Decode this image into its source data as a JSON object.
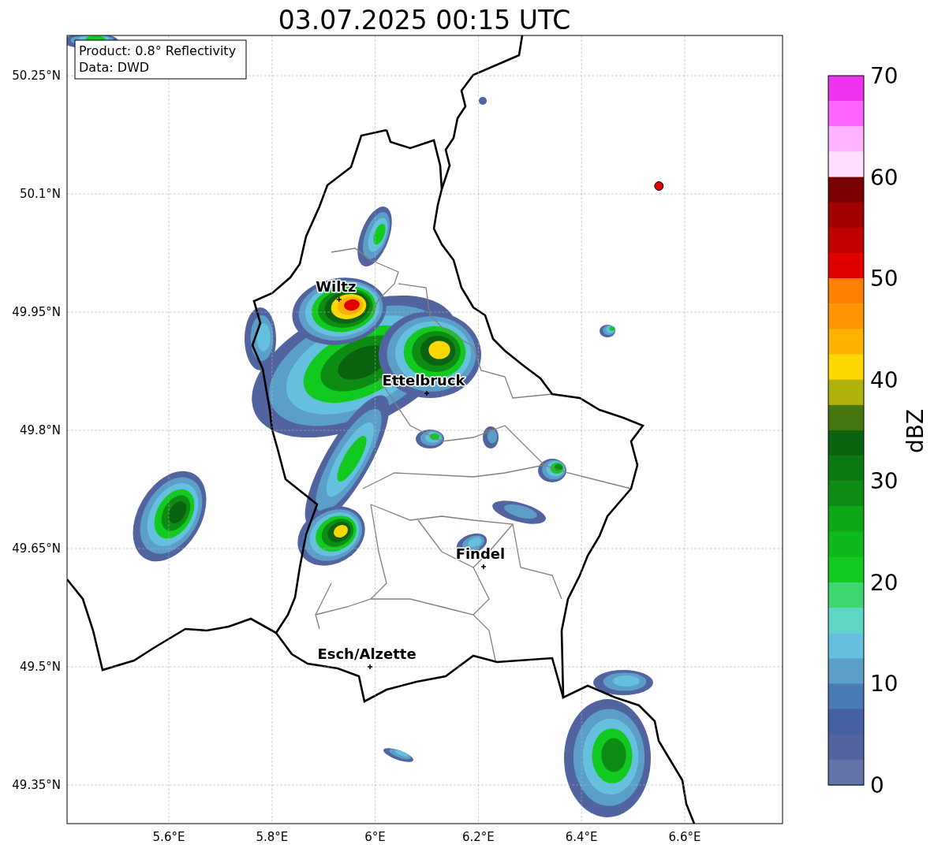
{
  "title": "03.07.2025 00:15 UTC",
  "info_box": [
    "Product: 0.8° Reflectivity",
    "Data: DWD"
  ],
  "lat_ticks": [
    "50.25°N",
    "50.1°N",
    "49.95°N",
    "49.8°N",
    "49.65°N",
    "49.5°N",
    "49.35°N"
  ],
  "lon_ticks": [
    "5.6°E",
    "5.8°E",
    "6°E",
    "6.2°E",
    "6.4°E",
    "6.6°E"
  ],
  "cities": [
    {
      "name": "Wiltz"
    },
    {
      "name": "Ettelbruck"
    },
    {
      "name": "Findel"
    },
    {
      "name": "Esch/Alzette"
    }
  ],
  "colorbar": {
    "label": "dBZ",
    "ticks": [
      "70",
      "60",
      "50",
      "40",
      "30",
      "20",
      "10",
      "0"
    ],
    "bands": [
      {
        "color": "#ee33ee"
      },
      {
        "color": "#ff66ff"
      },
      {
        "color": "#ffb3ff"
      },
      {
        "color": "#ffdfff"
      },
      {
        "color": "#7a0000"
      },
      {
        "color": "#a00000"
      },
      {
        "color": "#c00000"
      },
      {
        "color": "#e00000"
      },
      {
        "color": "#ff7f00"
      },
      {
        "color": "#ff9500"
      },
      {
        "color": "#ffb300"
      },
      {
        "color": "#ffd700"
      },
      {
        "color": "#b0b20b"
      },
      {
        "color": "#477611"
      },
      {
        "color": "#096310"
      },
      {
        "color": "#0a7912"
      },
      {
        "color": "#0c8c13"
      },
      {
        "color": "#0ea716"
      },
      {
        "color": "#0fb81b"
      },
      {
        "color": "#11c91f"
      },
      {
        "color": "#3dd672"
      },
      {
        "color": "#5ed6c6"
      },
      {
        "color": "#64c0dd"
      },
      {
        "color": "#5b9fc8"
      },
      {
        "color": "#4a7bb7"
      },
      {
        "color": "#4560a3"
      },
      {
        "color": "#52649f"
      },
      {
        "color": "#6374a8"
      }
    ]
  }
}
